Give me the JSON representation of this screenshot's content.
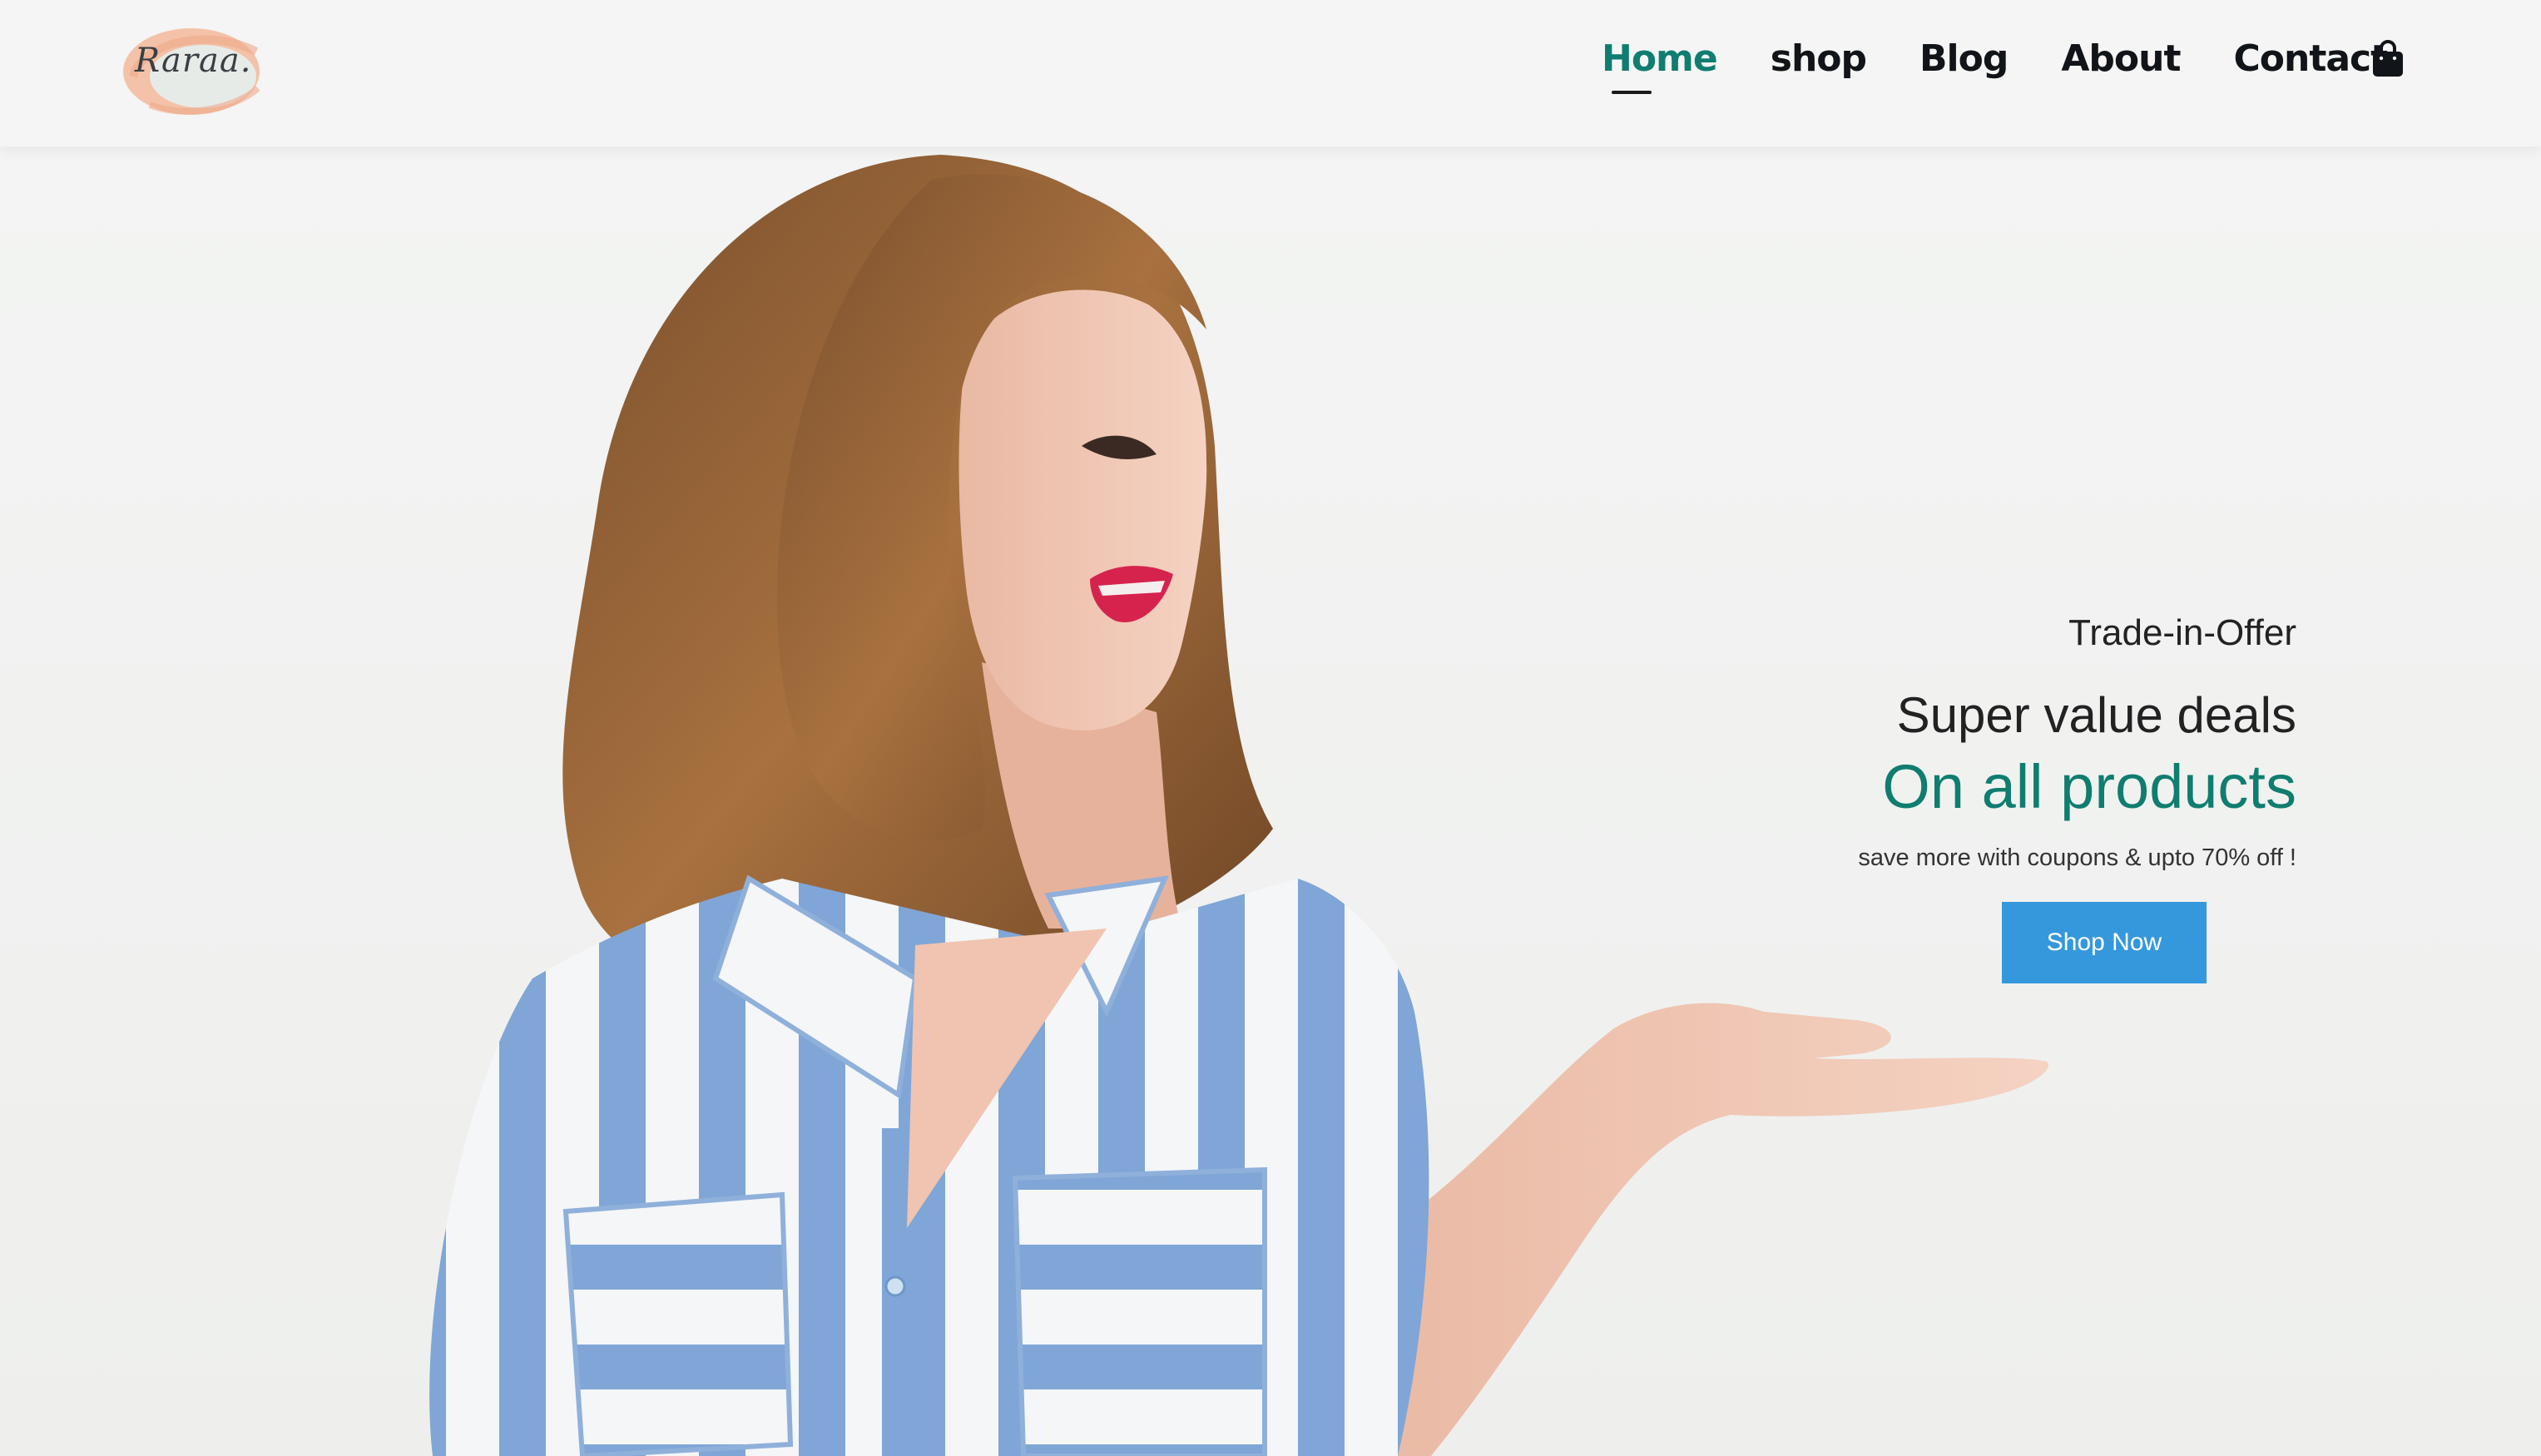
{
  "header": {
    "logo_text": "Raraa.",
    "nav": [
      {
        "label": "Home",
        "active": true
      },
      {
        "label": "shop",
        "active": false
      },
      {
        "label": "Blog",
        "active": false
      },
      {
        "label": "About",
        "active": false
      },
      {
        "label": "Contact",
        "active": false
      }
    ],
    "cart_icon": "shopping-bag-icon"
  },
  "hero": {
    "tag": "Trade-in-Offer",
    "headline": "Super value deals",
    "headline_accent": "On all products",
    "subtext": "save more with coupons & upto 70% off !",
    "cta_label": "Shop Now"
  },
  "colors": {
    "accent": "#0f7d70",
    "button": "#3598dc",
    "text": "#222222",
    "background": "#f1f2f0"
  }
}
